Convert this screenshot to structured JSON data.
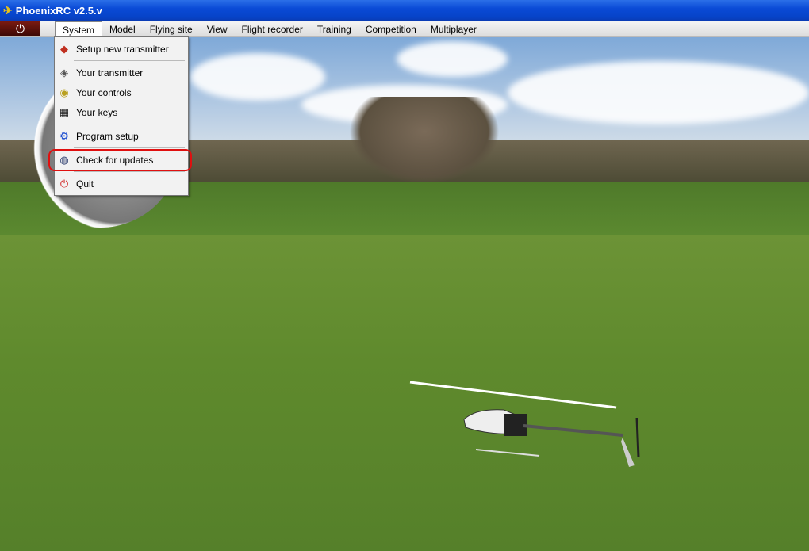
{
  "window": {
    "title": "PhoenixRC v2.5.v"
  },
  "menubar": {
    "items": [
      "System",
      "Model",
      "Flying site",
      "View",
      "Flight recorder",
      "Training",
      "Competition",
      "Multiplayer"
    ]
  },
  "system_menu": {
    "items": [
      {
        "label": "Setup new transmitter",
        "icon": "transmitter-setup-icon"
      },
      {
        "label": "Your transmitter",
        "icon": "transmitter-icon"
      },
      {
        "label": "Your controls",
        "icon": "controls-icon"
      },
      {
        "label": "Your keys",
        "icon": "keys-grid-icon"
      },
      {
        "label": "Program setup",
        "icon": "gear-icon"
      },
      {
        "label": "Check for updates",
        "icon": "globe-update-icon"
      },
      {
        "label": "Quit",
        "icon": "quit-power-icon"
      }
    ]
  },
  "colors": {
    "highlight": "#e01010",
    "title_bar": "#0a4ad6"
  }
}
